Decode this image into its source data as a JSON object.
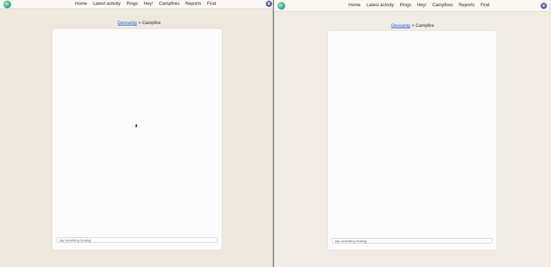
{
  "nav": {
    "items": [
      "Home",
      "Latest activity",
      "Pings",
      "Hey!",
      "Campfires",
      "Reports",
      "Find"
    ],
    "avatar_initial": "B"
  },
  "breadcrumb": {
    "project": "Devcamp",
    "separator": ">",
    "current": "Campfire"
  },
  "composer": {
    "placeholder": "Say something (muting)"
  },
  "icons": {
    "logo": "basecamp-logo-icon",
    "cursor": "mouse-pointer-icon"
  },
  "colors": {
    "background": "#efe9e1",
    "card": "#fdfcfd",
    "link": "#1e5bd6",
    "avatar": "#5b55a6"
  }
}
